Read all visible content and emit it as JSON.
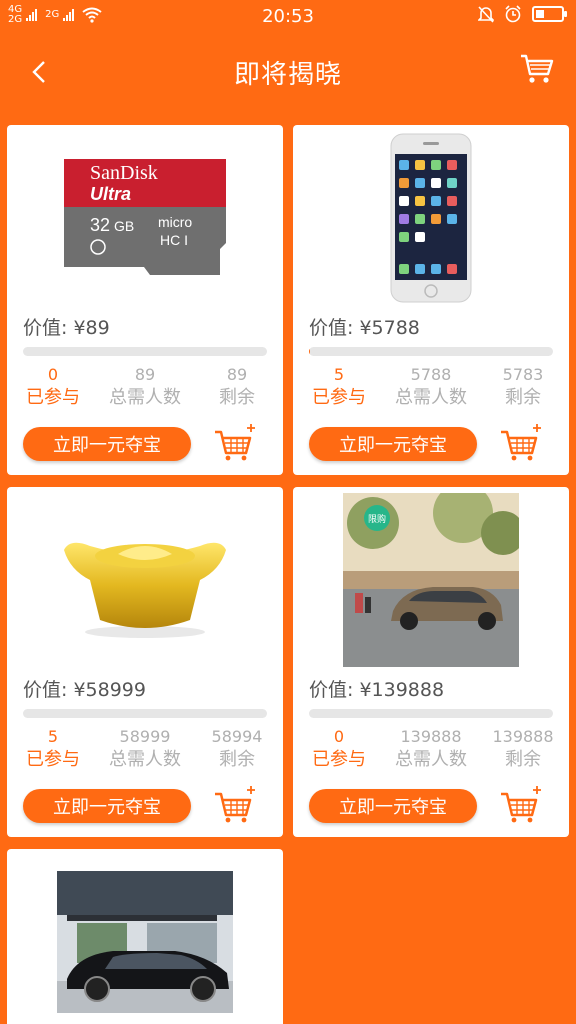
{
  "status_bar": {
    "network_1": "4G",
    "network_2": "2G",
    "network_3": "2G",
    "time": "20:53",
    "icons": [
      "mute-icon",
      "alarm-icon",
      "battery-icon"
    ]
  },
  "nav": {
    "title": "即将揭晓",
    "back_icon": "chevron-left-icon",
    "cart_icon": "shopping-cart-icon"
  },
  "labels": {
    "value_prefix": "价值: ",
    "joined": "已参与",
    "total": "总需人数",
    "remaining": "剩余",
    "buy_button": "立即一元夺宝"
  },
  "products": [
    {
      "image": "sandisk-ultra-32gb-card",
      "value": "¥89",
      "joined": "0",
      "total": "89",
      "remaining": "89",
      "progress": 0
    },
    {
      "image": "iphone",
      "value": "¥5788",
      "joined": "5",
      "total": "5788",
      "remaining": "5783",
      "progress": 0.001
    },
    {
      "image": "gold-ingot",
      "value": "¥58999",
      "joined": "5",
      "total": "58999",
      "remaining": "58994",
      "progress": 0.0001
    },
    {
      "image": "brown-sedan-car",
      "badge": "限购",
      "value": "¥139888",
      "joined": "0",
      "total": "139888",
      "remaining": "139888",
      "progress": 0
    },
    {
      "image": "black-bmw-sedan"
    }
  ],
  "colors": {
    "accent": "#ff6a13",
    "card_bg": "#ffffff",
    "muted_text": "#b0b0b0",
    "progress_track": "#e6e6e6"
  }
}
